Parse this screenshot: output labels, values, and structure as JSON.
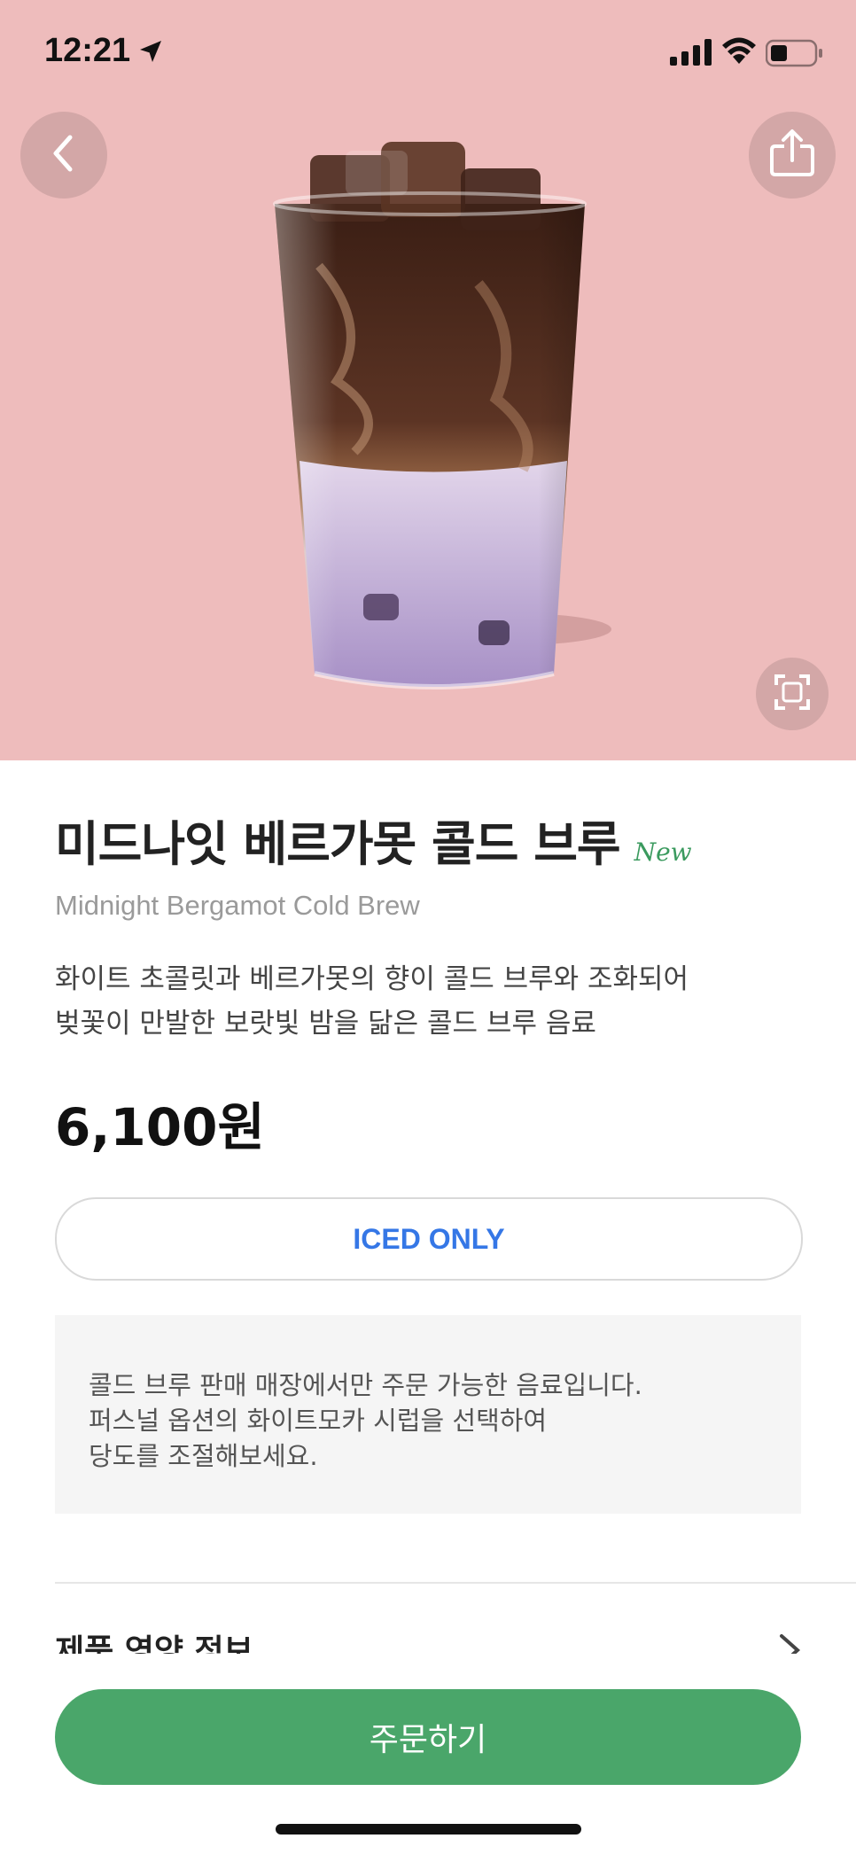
{
  "status_bar": {
    "time": "12:21"
  },
  "icons": {
    "location": "location-arrow-icon",
    "signal": "cellular-signal-icon",
    "wifi": "wifi-icon",
    "battery": "battery-icon",
    "back": "chevron-left-icon",
    "share": "share-icon",
    "expand": "fullscreen-icon",
    "nutrition": "chevron-right-icon"
  },
  "colors": {
    "hero_bg": "#eebcbc",
    "accent_green": "#4aa66a",
    "new_badge": "#3a9a5e",
    "iced_text": "#3577e6"
  },
  "product": {
    "name_ko": "미드나잇 베르가못 콜드 브루",
    "badge": "New",
    "name_en": "Midnight Bergamot Cold Brew",
    "description_lines": [
      "화이트 초콜릿과 베르가못의 향이 콜드 브루와 조화되어",
      "벚꽃이 만발한 보랏빛 밤을 닮은 콜드 브루 음료"
    ],
    "price": "6,100원",
    "temperature_option": "ICED ONLY"
  },
  "notice": {
    "lines": [
      "콜드 브루 판매 매장에서만 주문 가능한 음료입니다.",
      "퍼스널 옵션의 화이트모카 시럽을 선택하여",
      "당도를 조절해보세요."
    ]
  },
  "nutrition": {
    "label": "제품 영양 정보"
  },
  "order": {
    "button_label": "주문하기"
  }
}
